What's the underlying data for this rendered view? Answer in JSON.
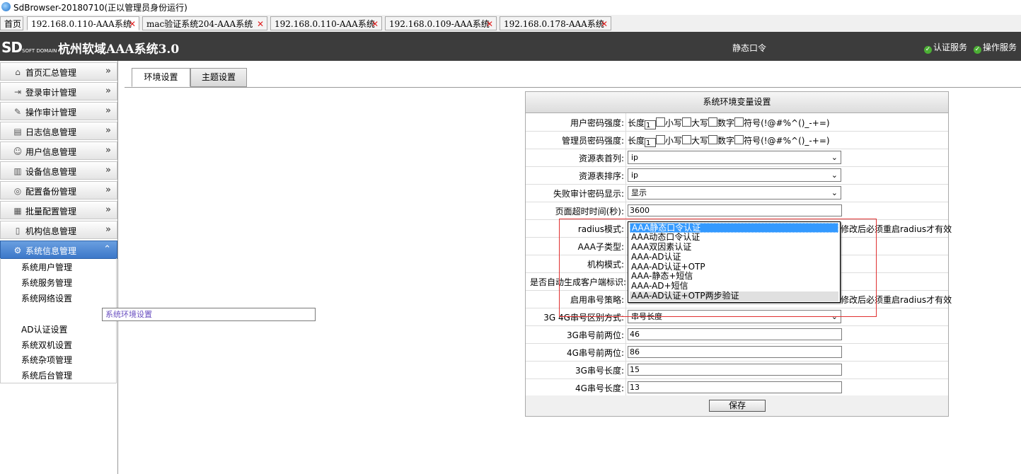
{
  "window": {
    "title": "SdBrowser-20180710(正以管理员身份运行)"
  },
  "browser_tabs": [
    {
      "label": "首页",
      "closable": false
    },
    {
      "label": "192.168.0.110-AAA系统",
      "closable": true,
      "active": true
    },
    {
      "label": "mac验证系统204-AAA系统",
      "closable": true
    },
    {
      "label": "192.168.0.110-AAA系统",
      "closable": true
    },
    {
      "label": "192.168.0.109-AAA系统",
      "closable": true
    },
    {
      "label": "192.168.0.178-AAA系统",
      "closable": true
    }
  ],
  "header": {
    "logo": "SD",
    "logo_sub": "SOFT DOMAIN",
    "system_title": "杭州软域AAA系统3.0",
    "center_text": "静态口令",
    "services": [
      "认证服务",
      "操作服务"
    ]
  },
  "sidebar": {
    "menus": [
      {
        "label": "首页汇总管理",
        "icon": "home-icon"
      },
      {
        "label": "登录审计管理",
        "icon": "login-icon"
      },
      {
        "label": "操作审计管理",
        "icon": "wrench-icon"
      },
      {
        "label": "日志信息管理",
        "icon": "calendar-icon"
      },
      {
        "label": "用户信息管理",
        "icon": "user-icon"
      },
      {
        "label": "设备信息管理",
        "icon": "device-icon"
      },
      {
        "label": "配置备份管理",
        "icon": "database-icon"
      },
      {
        "label": "批量配置管理",
        "icon": "batch-icon"
      },
      {
        "label": "机构信息管理",
        "icon": "building-icon"
      },
      {
        "label": "系统信息管理",
        "icon": "gear-icon",
        "open": true
      }
    ],
    "submenu": [
      "系统用户管理",
      "系统服务管理",
      "系统网络设置",
      "系统环境设置",
      "AD认证设置",
      "系统双机设置",
      "系统杂项管理",
      "系统后台管理"
    ],
    "submenu_selected": "系统环境设置"
  },
  "content_tabs": [
    "环境设置",
    "主题设置"
  ],
  "form": {
    "title": "系统环境变量设置",
    "pw_parts": {
      "length": "长度",
      "length_value": "1",
      "lower": "小写",
      "upper": "大写",
      "digit": "数字",
      "symbol": "符号(!@#%^()_-+=)"
    },
    "user_pw_label": "用户密码强度:",
    "admin_pw_label": "管理员密码强度:",
    "resource_first_col": {
      "label": "资源表首列:",
      "value": "ip"
    },
    "resource_sort": {
      "label": "资源表排序:",
      "value": "ip"
    },
    "fail_audit_pw": {
      "label": "失败审计密码显示:",
      "value": "显示"
    },
    "timeout": {
      "label": "页面超时时间(秒):",
      "value": "3600"
    },
    "radius_mode": {
      "label": "radius模式:",
      "note": "修改后必须重启radius才有效"
    },
    "aaa_subtype": {
      "label": "AAA子类型:"
    },
    "org_mode": {
      "label": "机构模式:"
    },
    "auto_client_id": {
      "label": "是否自动生成客户端标识:"
    },
    "serial_policy": {
      "label": "启用串号策略:",
      "note": "修改后必须重启radius才有效"
    },
    "serial_3g4g": {
      "label": "3G 4G串号区别方式:",
      "value": "串号长度"
    },
    "prefix_3g": {
      "label": "3G串号前两位:",
      "value": "46"
    },
    "prefix_4g": {
      "label": "4G串号前两位:",
      "value": "86"
    },
    "len_3g": {
      "label": "3G串号长度:",
      "value": "15"
    },
    "len_4g": {
      "label": "4G串号长度:",
      "value": "13"
    },
    "save_label": "保存"
  },
  "dropdown_options": [
    "AAA静态口令认证",
    "AAA动态口令认证",
    "AAA双因素认证",
    "AAA-AD认证",
    "AAA-AD认证+OTP",
    "AAA-静态+短信",
    "AAA-AD+短信",
    "AAA-AD认证+OTP两步验证"
  ],
  "dropdown_highlighted": "AAA静态口令认证",
  "colors": {
    "header_bg": "#3c3c3c",
    "menu_open": "#3c78c9",
    "highlight": "#3399ff",
    "annotation_box": "#e03030",
    "check_green": "#4caf35"
  }
}
